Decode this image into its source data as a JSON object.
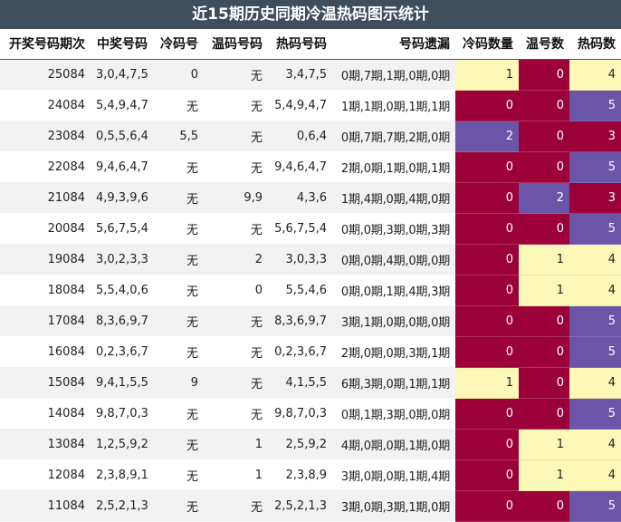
{
  "title": "近15期历史同期冷温热码图示统计",
  "headers": [
    "开奖号码期次",
    "中奖号码",
    "冷码号",
    "温码号码",
    "热码号码",
    "号码遗漏",
    "冷码数量",
    "温号数",
    "热码数"
  ],
  "rows": [
    {
      "period": "25084",
      "winning": "3,0,4,7,5",
      "cold": "0",
      "warm": "无",
      "hot": "3,4,7,5",
      "omission": "0期,7期,1期,0期,0期",
      "cold_count": "1",
      "warm_count": "0",
      "hot_count": "4"
    },
    {
      "period": "24084",
      "winning": "5,4,9,4,7",
      "cold": "无",
      "warm": "无",
      "hot": "5,4,9,4,7",
      "omission": "1期,1期,0期,1期,1期",
      "cold_count": "0",
      "warm_count": "0",
      "hot_count": "5"
    },
    {
      "period": "23084",
      "winning": "0,5,5,6,4",
      "cold": "5,5",
      "warm": "无",
      "hot": "0,6,4",
      "omission": "0期,7期,7期,2期,0期",
      "cold_count": "2",
      "warm_count": "0",
      "hot_count": "3"
    },
    {
      "period": "22084",
      "winning": "9,4,6,4,7",
      "cold": "无",
      "warm": "无",
      "hot": "9,4,6,4,7",
      "omission": "2期,0期,1期,0期,1期",
      "cold_count": "0",
      "warm_count": "0",
      "hot_count": "5"
    },
    {
      "period": "21084",
      "winning": "4,9,3,9,6",
      "cold": "无",
      "warm": "9,9",
      "hot": "4,3,6",
      "omission": "1期,4期,0期,4期,0期",
      "cold_count": "0",
      "warm_count": "2",
      "hot_count": "3"
    },
    {
      "period": "20084",
      "winning": "5,6,7,5,4",
      "cold": "无",
      "warm": "无",
      "hot": "5,6,7,5,4",
      "omission": "0期,0期,3期,0期,3期",
      "cold_count": "0",
      "warm_count": "0",
      "hot_count": "5"
    },
    {
      "period": "19084",
      "winning": "3,0,2,3,3",
      "cold": "无",
      "warm": "2",
      "hot": "3,0,3,3",
      "omission": "0期,0期,4期,0期,0期",
      "cold_count": "0",
      "warm_count": "1",
      "hot_count": "4"
    },
    {
      "period": "18084",
      "winning": "5,5,4,0,6",
      "cold": "无",
      "warm": "0",
      "hot": "5,5,4,6",
      "omission": "0期,0期,1期,4期,3期",
      "cold_count": "0",
      "warm_count": "1",
      "hot_count": "4"
    },
    {
      "period": "17084",
      "winning": "8,3,6,9,7",
      "cold": "无",
      "warm": "无",
      "hot": "8,3,6,9,7",
      "omission": "3期,1期,0期,0期,0期",
      "cold_count": "0",
      "warm_count": "0",
      "hot_count": "5"
    },
    {
      "period": "16084",
      "winning": "0,2,3,6,7",
      "cold": "无",
      "warm": "无",
      "hot": "0,2,3,6,7",
      "omission": "2期,0期,0期,3期,1期",
      "cold_count": "0",
      "warm_count": "0",
      "hot_count": "5"
    },
    {
      "period": "15084",
      "winning": "9,4,1,5,5",
      "cold": "9",
      "warm": "无",
      "hot": "4,1,5,5",
      "omission": "6期,3期,0期,1期,1期",
      "cold_count": "1",
      "warm_count": "0",
      "hot_count": "4"
    },
    {
      "period": "14084",
      "winning": "9,8,7,0,3",
      "cold": "无",
      "warm": "无",
      "hot": "9,8,7,0,3",
      "omission": "0期,1期,3期,0期,0期",
      "cold_count": "0",
      "warm_count": "0",
      "hot_count": "5"
    },
    {
      "period": "13084",
      "winning": "1,2,5,9,2",
      "cold": "无",
      "warm": "1",
      "hot": "2,5,9,2",
      "omission": "4期,0期,0期,1期,0期",
      "cold_count": "0",
      "warm_count": "1",
      "hot_count": "4"
    },
    {
      "period": "12084",
      "winning": "2,3,8,9,1",
      "cold": "无",
      "warm": "1",
      "hot": "2,3,8,9",
      "omission": "3期,0期,0期,1期,4期",
      "cold_count": "0",
      "warm_count": "1",
      "hot_count": "4"
    },
    {
      "period": "11084",
      "winning": "2,5,2,1,3",
      "cold": "无",
      "warm": "无",
      "hot": "2,5,2,1,3",
      "omission": "3期,0期,3期,1期,0期",
      "cold_count": "0",
      "warm_count": "0",
      "hot_count": "5"
    }
  ],
  "colors": {
    "title_bg": "#3e4e5c",
    "hot_cell": "#9c0039",
    "warm_cell": "#6a55a8",
    "cold_cell": "#fbf8b8"
  }
}
